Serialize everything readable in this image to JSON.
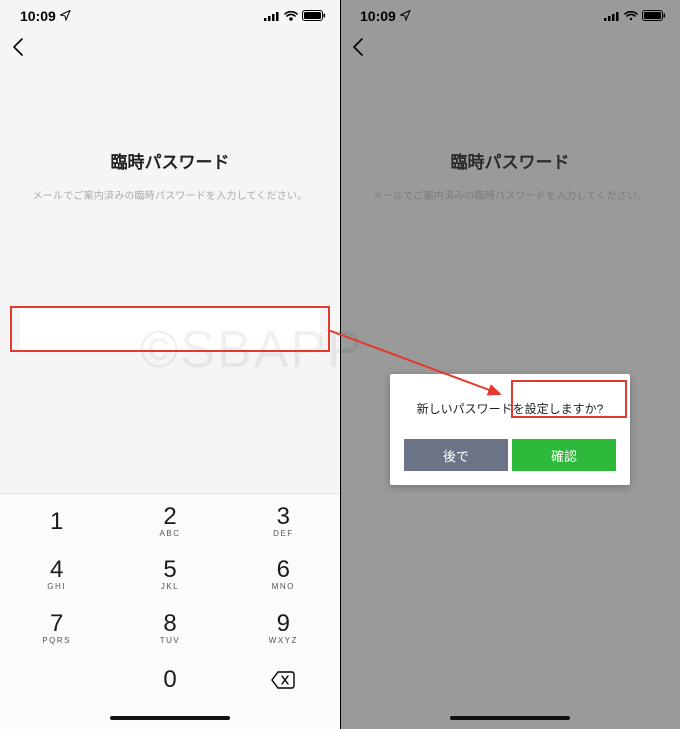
{
  "status": {
    "time": "10:09"
  },
  "screen": {
    "title": "臨時パスワード",
    "subtitle": "メールでご案内済みの臨時パスワードを入力してください。"
  },
  "keypad": {
    "keys": [
      {
        "num": "1",
        "letters": ""
      },
      {
        "num": "2",
        "letters": "ABC"
      },
      {
        "num": "3",
        "letters": "DEF"
      },
      {
        "num": "4",
        "letters": "GHI"
      },
      {
        "num": "5",
        "letters": "JKL"
      },
      {
        "num": "6",
        "letters": "MNO"
      },
      {
        "num": "7",
        "letters": "PQRS"
      },
      {
        "num": "8",
        "letters": "TUV"
      },
      {
        "num": "9",
        "letters": "WXYZ"
      },
      {
        "num": "",
        "letters": ""
      },
      {
        "num": "0",
        "letters": ""
      },
      {
        "num": "⌫",
        "letters": ""
      }
    ]
  },
  "dialog": {
    "message": "新しいパスワードを設定しますか?",
    "later": "後で",
    "confirm": "確認"
  },
  "watermark": "©SBAPP"
}
